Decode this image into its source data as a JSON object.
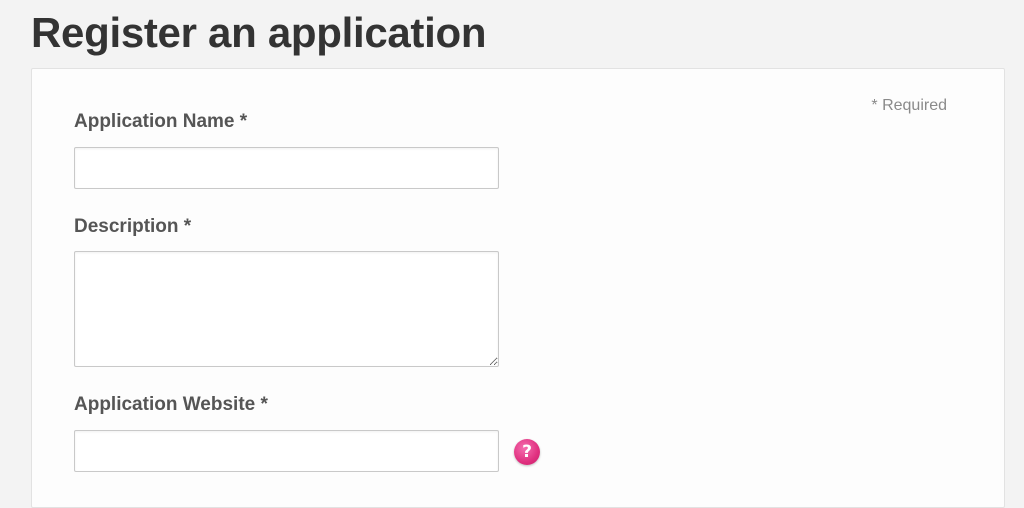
{
  "page": {
    "title": "Register an application"
  },
  "form": {
    "required_note": "* Required",
    "fields": [
      {
        "label": "Application Name *",
        "value": "",
        "type": "text"
      },
      {
        "label": "Description *",
        "value": "",
        "type": "textarea"
      },
      {
        "label": "Application Website *",
        "value": "",
        "type": "text"
      }
    ],
    "help_icon_glyph": "?"
  },
  "colors": {
    "background": "#f3f3f3",
    "panel": "#fdfdfd",
    "title": "#333333",
    "label": "#555555",
    "help_icon": "#e0307f"
  },
  "icons": {
    "help": "help-question-icon"
  }
}
